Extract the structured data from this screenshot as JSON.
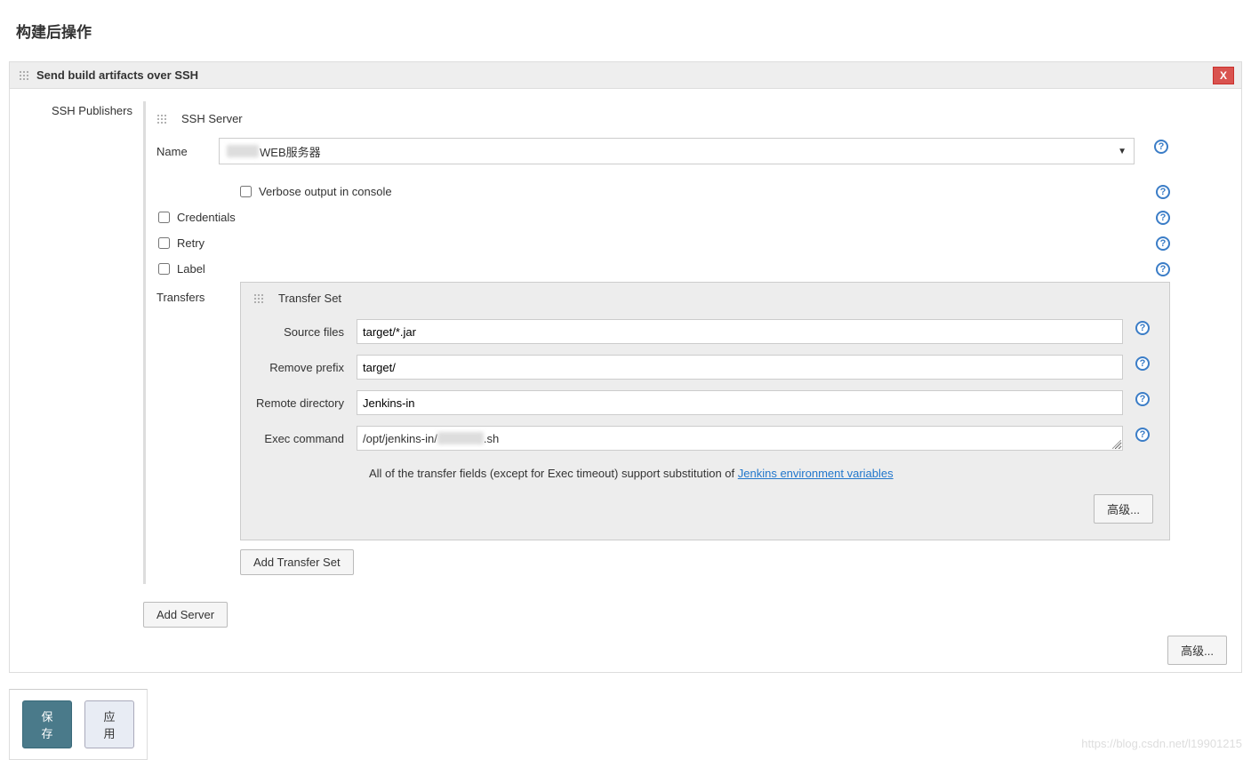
{
  "page_title": "构建后操作",
  "step": {
    "title": "Send build artifacts over SSH",
    "close": "X"
  },
  "labels": {
    "ssh_publishers": "SSH Publishers",
    "ssh_server": "SSH Server",
    "name": "Name",
    "verbose": "Verbose output in console",
    "credentials": "Credentials",
    "retry": "Retry",
    "label": "Label",
    "transfers": "Transfers",
    "transfer_set": "Transfer Set",
    "source_files": "Source files",
    "remove_prefix": "Remove prefix",
    "remote_directory": "Remote directory",
    "exec_command": "Exec command",
    "add_transfer_set": "Add Transfer Set",
    "add_server": "Add Server",
    "advanced": "高级...",
    "save": "保存",
    "apply": "应用"
  },
  "values": {
    "server_name": "WEB服务器",
    "source_files": "target/*.jar",
    "remove_prefix": "target/",
    "remote_directory": "Jenkins-in",
    "exec_command_prefix": "/opt/jenkins-in/",
    "exec_command_suffix": ".sh"
  },
  "note": {
    "prefix": "All of the transfer fields (except for Exec timeout) support substitution of ",
    "link": "Jenkins environment variables"
  },
  "watermark": "https://blog.csdn.net/l19901215"
}
